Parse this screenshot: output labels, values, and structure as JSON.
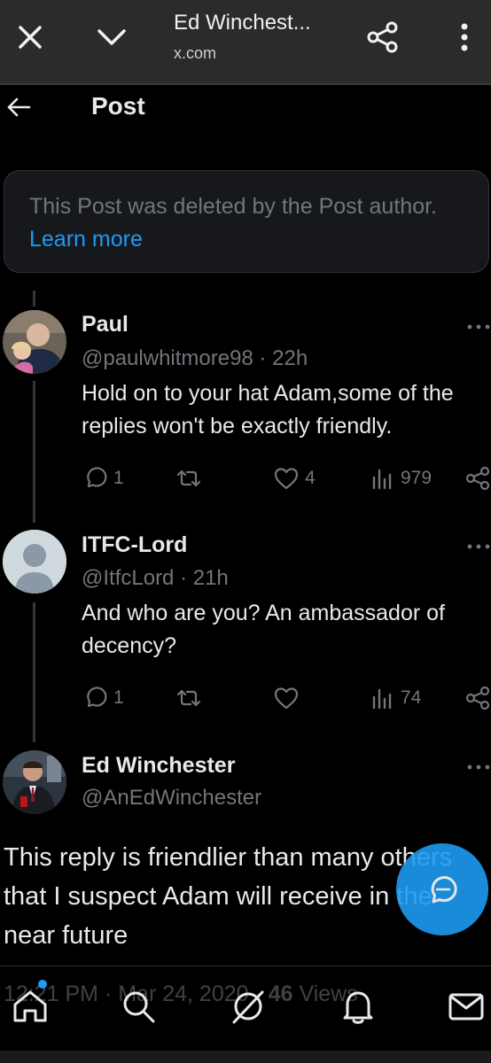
{
  "browser": {
    "title": "Ed Winchest...",
    "url": "x.com"
  },
  "header": {
    "title": "Post"
  },
  "deleted_notice": {
    "text": "This Post was deleted by the Post author.",
    "link": "Learn more"
  },
  "replies": [
    {
      "name": "Paul",
      "handle_time": "@paulwhitmore98 · 22h",
      "text": "Hold on to your hat Adam,some of the replies won't be exactly friendly.",
      "reply_count": "1",
      "like_count": "4",
      "view_count": "979"
    },
    {
      "name": "ITFC-Lord",
      "handle_time": "@ItfcLord · 21h",
      "text": "And who are you? An ambassador of decency?",
      "reply_count": "1",
      "like_count": "",
      "view_count": "74"
    }
  ],
  "main_post": {
    "name": "Ed Winchester",
    "handle": "@AnEdWinchester",
    "text": "This reply is friendlier than many others that I suspect Adam will receive in the near future",
    "timestamp": "12:21 PM · Mar 24, 2020 ·",
    "views": "46",
    "views_label": "Views"
  },
  "icons": {
    "close": "close-icon",
    "collapse": "chevron-down-icon",
    "share": "share-icon",
    "menu": "more-vertical-icon",
    "back": "arrow-left-icon",
    "reply": "reply-icon",
    "repost": "repost-icon",
    "like": "heart-icon",
    "views": "analytics-icon",
    "fab": "compose-reply-icon",
    "home": "home-icon",
    "search": "search-icon",
    "grok": "grok-icon",
    "notifications": "bell-icon",
    "messages": "envelope-icon"
  },
  "colors": {
    "accent": "#1d9bf0",
    "background": "#000000",
    "muted": "#71767b",
    "text": "#e7e9ea"
  }
}
